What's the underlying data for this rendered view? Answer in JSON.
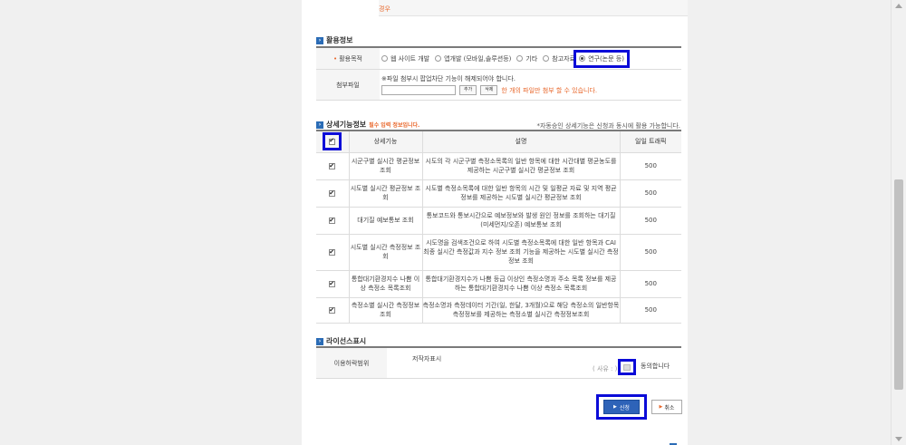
{
  "top_note": {
    "line1": "",
    "line2": "경우"
  },
  "usage": {
    "section_title": "활용정보",
    "purpose_label": "활용목적",
    "options": [
      {
        "label": "웹 사이트 개발",
        "selected": false
      },
      {
        "label": "앱개발 (모바일,솔루션등)",
        "selected": false
      },
      {
        "label": "기타",
        "selected": false
      },
      {
        "label": "참고자료",
        "selected": false
      },
      {
        "label": "연구(논문 등)",
        "selected": true
      }
    ],
    "attach_label": "첨부파일",
    "attach_note": "※파일 첨부시 팝업차단 기능이 해제되어야 합니다.",
    "add_button": "추가",
    "delete_button": "삭제",
    "attach_limit": "한 개의 파일만 첨부 할 수 있습니다."
  },
  "detail": {
    "section_title": "상세기능정보",
    "required_note": "필수 입력 정보입니다.",
    "right_note": "*자동승인 상세기능은 신청과 동시에 활용 가능합니다.",
    "headers": {
      "feature": "상세기능",
      "description": "설명",
      "traffic": "일일 트래픽"
    },
    "rows": [
      {
        "checked": true,
        "feature": "시군구별 실시간 평균정보 조회",
        "description": "시도의 각 시군구별 측정소목록의 일반 항목에 대한 시간대별 평균농도를 제공하는 시군구별 실시간 평균정보 조회",
        "traffic": "500"
      },
      {
        "checked": true,
        "feature": "시도별 실시간 평균정보 조회",
        "description": "시도별 측정소목록에 대한 일반 항목의 시간 및 일평균 자료 및 지역 평균 정보를 제공하는 시도별 실시간 평균정보 조회",
        "traffic": "500"
      },
      {
        "checked": true,
        "feature": "대기질 예보통보 조회",
        "description": "통보코드와 통보시간으로 예보정보와 발생 원인 정보를 조회하는 대기질(미세먼지/오존) 예보통보 조회",
        "traffic": "500"
      },
      {
        "checked": true,
        "feature": "시도별 실시간 측정정보 조회",
        "description": "시도명을 검색조건으로 하여 시도별 측정소목록에 대한 일반 항목과 CAI 최종 실시간 측정값과 지수 정보 조회 기능을 제공하는 시도별 실시간 측정정보 조회",
        "traffic": "500"
      },
      {
        "checked": true,
        "feature": "통합대기환경지수 나쁨 이상 측정소 목록조회",
        "description": "통합대기환경지수가 나쁨 등급 이상인 측정소명과 주소 목록 정보를 제공하는 통합대기환경지수 나쁨 이상 측정소 목록조회",
        "traffic": "500"
      },
      {
        "checked": true,
        "feature": "측정소별 실시간 측정정보 조회",
        "description": "측정소명과 측정데이터 기간(일, 한달, 3개월)으로 해당 측정소의 일반항목 측정정보를 제공하는 측정소별 실시간 측정정보조회",
        "traffic": "500"
      }
    ]
  },
  "license": {
    "section_title": "라이선스표시",
    "scope_label": "이용허락범위",
    "value": "저작자표시",
    "reason": "( 사유 : )",
    "agree_text": "동의합니다"
  },
  "actions": {
    "submit": "신청",
    "cancel": "취소"
  }
}
